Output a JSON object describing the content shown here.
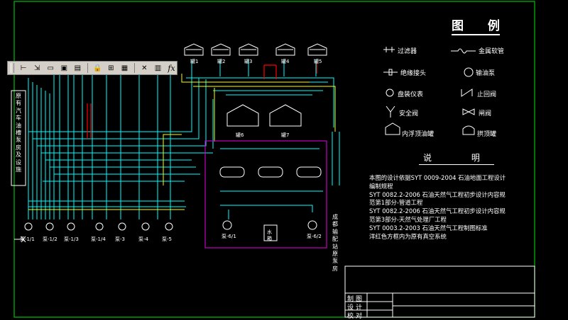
{
  "toolbar": {
    "buttons": [
      "dimension-linear-icon",
      "dimension-tool-icon",
      "dimension-edit-icon",
      "dimension-style-icon",
      "dimension-update-icon",
      "lock-icon",
      "field-icon",
      "frame-icon",
      "delete-icon",
      "frame-edit-icon",
      "formula-icon"
    ],
    "fx_label": "fx"
  },
  "legend": {
    "title": "图 例",
    "items": {
      "filter": "过滤器",
      "hose": "金属软管",
      "insulated_joint": "绝缘接头",
      "oil_pump": "输油泵",
      "gauge": "盘装仪表",
      "check_valve": "止回阀",
      "safety_valve": "安全阀",
      "gate_valve": "闸阀",
      "floating_tank": "内浮顶油罐",
      "dome_tank": "拱顶罐"
    }
  },
  "notes": {
    "title": "说 明",
    "lines": [
      "本图的设计依据SYT 0009-2004 石油地面工程设计",
      "编制规程",
      "SYT 0082.2-2006 石油天然气工程初步设计内容规",
      "范第1部分-管道工程",
      "SYT 0082.2-2006 石油天然气工程初步设计内容规",
      "范第3部分-天然气处理厂工程",
      "SYT 0003.2-2003 石油天然气工程制图标准",
      "洋红色方框内为原有真空系统"
    ]
  },
  "side_box_text": "原有汽车油槽泵房及设施",
  "right_vertical_text": "成都输配站原泵房",
  "tanks": [
    "罐1",
    "罐2",
    "罐3",
    "罐4",
    "罐5",
    "罐6",
    "罐7"
  ],
  "pumps": [
    "泵-1/1",
    "泵-1/2",
    "泵-1/3",
    "泵-1/4",
    "泵-3",
    "泵-4",
    "泵-5"
  ],
  "vacuum": {
    "pump_a": "泵-6/1",
    "pump_b": "泵-6/2",
    "water_tank": "水箱"
  },
  "title_block": {
    "row1": "制图",
    "row2": "设计",
    "row3": "校对"
  },
  "colors": {
    "border": "#00c000",
    "cyan": "#00ffff",
    "yellow": "#ffff00",
    "red": "#ff0000",
    "magenta": "#c000c0",
    "white": "#ffffff"
  }
}
